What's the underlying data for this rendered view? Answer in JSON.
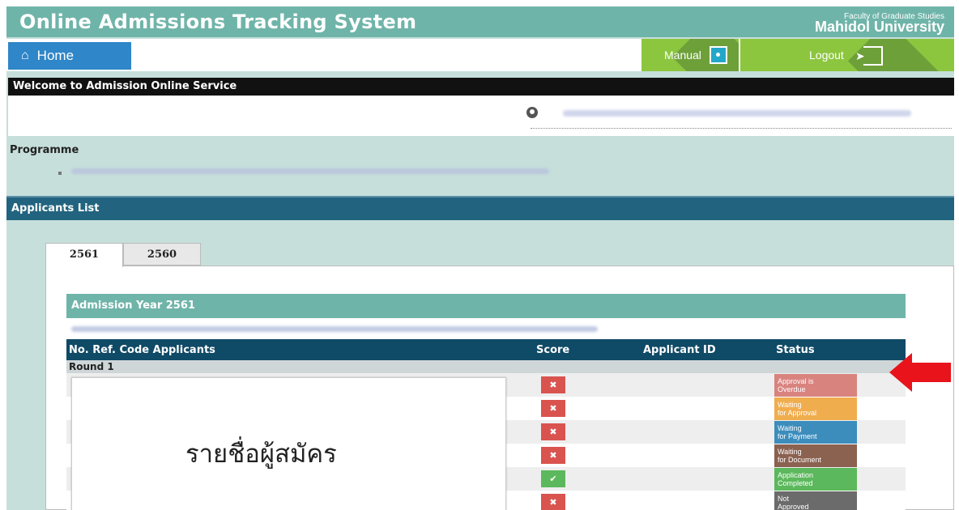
{
  "header": {
    "title": "Online Admissions Tracking System",
    "faculty_sub": "Faculty of Graduate Studies",
    "faculty_main": "Mahidol University"
  },
  "nav": {
    "home_label": "Home",
    "home_icon": "home-icon",
    "manual_label": "Manual",
    "logout_label": "Logout"
  },
  "welcome": {
    "title": "Welcome to Admission Online Service"
  },
  "programme": {
    "label": "Programme"
  },
  "applicants": {
    "section_title": "Applicants List",
    "tabs": [
      {
        "label": "2561",
        "active": true
      },
      {
        "label": "2560",
        "active": false
      }
    ],
    "year_title": "Admission Year 2561",
    "columns": [
      "No. Ref. Code Applicants",
      "Score",
      "Applicant ID",
      "Status"
    ],
    "round": "Round 1",
    "rows": [
      {
        "score": "x",
        "status": "Approval is\nOverdue",
        "status_color": "#d9837f"
      },
      {
        "score": "x",
        "status": "Waiting\nfor Approval",
        "status_color": "#f0ad4e"
      },
      {
        "score": "x",
        "status": "Waiting\nfor Payment",
        "status_color": "#3c8dbc"
      },
      {
        "score": "x",
        "status": "Waiting\nfor Document",
        "status_color": "#8b6150"
      },
      {
        "score": "check",
        "status": "Application\nCompleted",
        "status_color": "#5cb85c"
      },
      {
        "score": "x",
        "status": "Not\nApproved",
        "status_color": "#6b6b6b"
      }
    ]
  },
  "overlay": {
    "text": "รายชื่อผู้สมัคร"
  },
  "colors": {
    "header": "#6fb4a9",
    "page_bg": "#c6dfdb",
    "home": "#2f86c8",
    "nav_green": "#8cc63f",
    "applist_bar": "#22647f",
    "table_head": "#0f4a66",
    "arrow": "#e8131b"
  }
}
